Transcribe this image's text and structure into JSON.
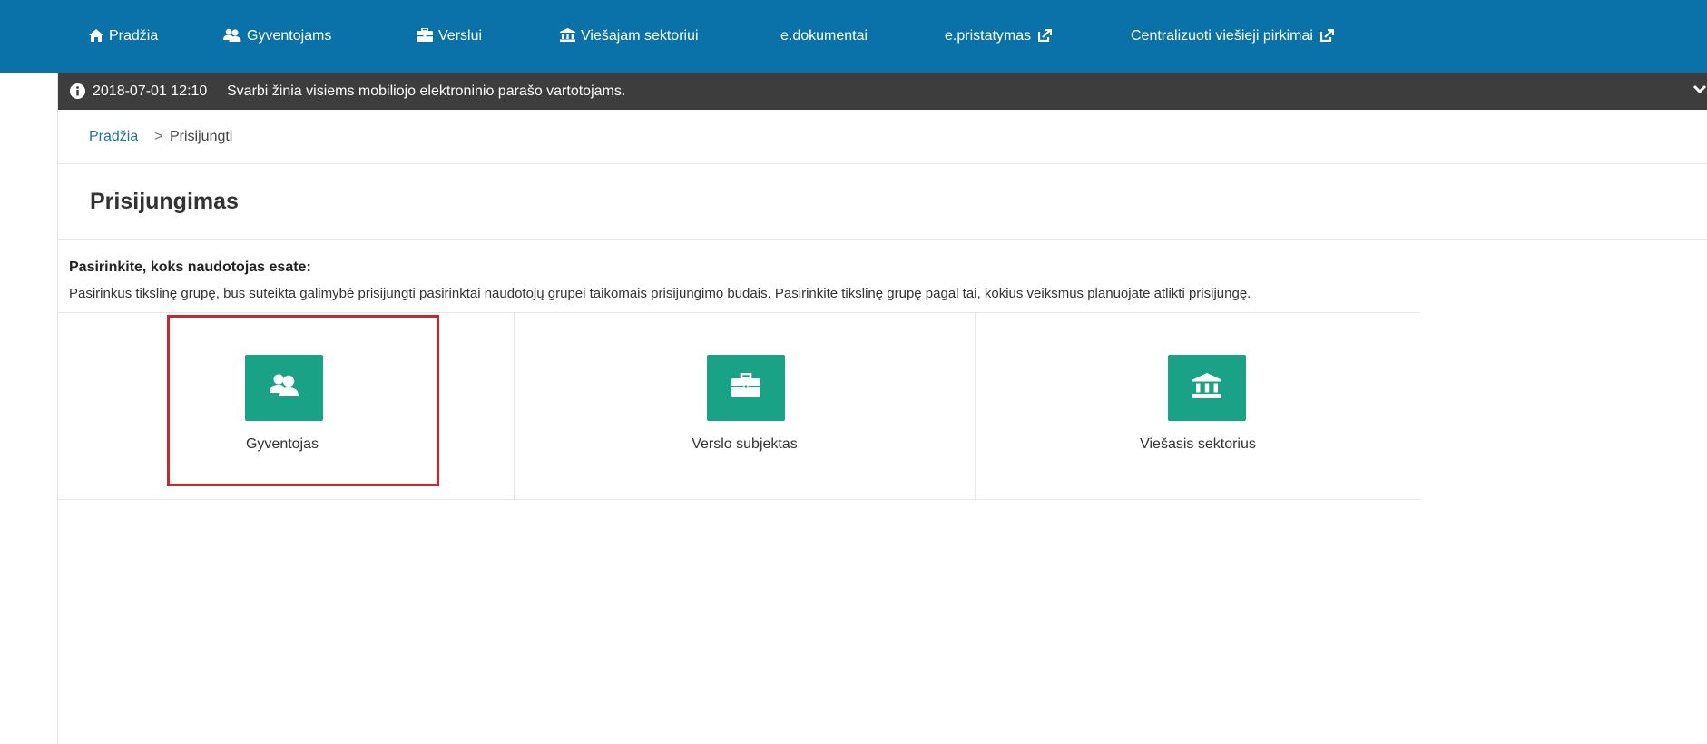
{
  "colors": {
    "nav_bg": "#0a72a8",
    "notice_bg": "#3d3d3d",
    "tile_green": "#1aa287",
    "link_blue": "#1a73ad",
    "highlight_red": "#d0232b"
  },
  "nav": {
    "items": [
      {
        "label": "Pradžia",
        "icon": "home-icon"
      },
      {
        "label": "Gyventojams",
        "icon": "users-icon"
      },
      {
        "label": "Verslui",
        "icon": "briefcase-icon"
      },
      {
        "label": "Viešajam sektoriui",
        "icon": "institution-icon"
      },
      {
        "label": "e.dokumentai"
      },
      {
        "label": "e.pristatymas",
        "icon": "external-link-icon"
      },
      {
        "label": "Centralizuoti viešieji pirkimai",
        "icon": "external-link-icon"
      }
    ]
  },
  "notice": {
    "date": "2018-07-01 12:10",
    "text": "Svarbi žinia visiems mobiliojo elektroninio parašo vartotojams."
  },
  "breadcrumb": {
    "home": "Pradžia",
    "separator": ">",
    "current": "Prisijungti"
  },
  "page": {
    "title": "Prisijungimas",
    "intro_heading": "Pasirinkite, koks naudotojas esate:",
    "intro_text": "Pasirinkus tikslinę grupę, bus suteikta galimybė prisijungti pasirinktai naudotojų grupei taikomais prisijungimo būdais. Pasirinkite tikslinę grupę pagal tai, kokius veiksmus planuojate atlikti prisijungę."
  },
  "choices": [
    {
      "label": "Gyventojas",
      "icon": "users-icon",
      "highlighted": true
    },
    {
      "label": "Verslo subjektas",
      "icon": "briefcase-icon"
    },
    {
      "label": "Viešasis sektorius",
      "icon": "institution-icon"
    }
  ]
}
